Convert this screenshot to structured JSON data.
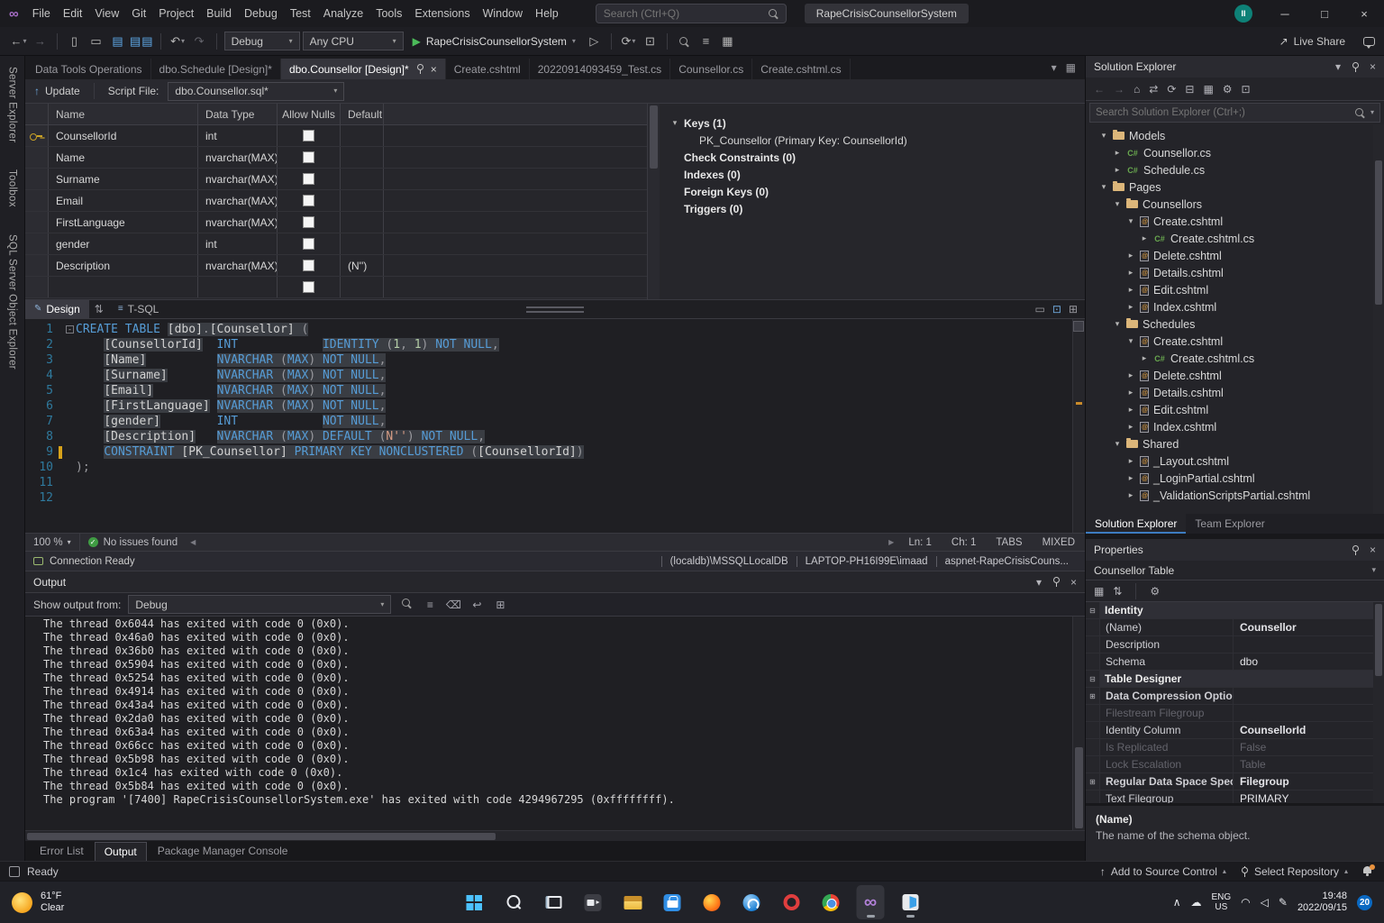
{
  "titlebar": {
    "menus": [
      "File",
      "Edit",
      "View",
      "Git",
      "Project",
      "Build",
      "Debug",
      "Test",
      "Analyze",
      "Tools",
      "Extensions",
      "Window",
      "Help"
    ],
    "search_placeholder": "Search (Ctrl+Q)",
    "project_pill": "RapeCrisisCounsellorSystem",
    "avatar_initials": "II"
  },
  "toolbar": {
    "config": "Debug",
    "platform": "Any CPU",
    "run": "RapeCrisisCounsellorSystem",
    "live_share": "Live Share"
  },
  "tabs": [
    {
      "label": "Data Tools Operations",
      "active": false
    },
    {
      "label": "dbo.Schedule [Design]*",
      "active": false
    },
    {
      "label": "dbo.Counsellor [Design]*",
      "active": true
    },
    {
      "label": "Create.cshtml",
      "active": false
    },
    {
      "label": "20220914093459_Test.cs",
      "active": false
    },
    {
      "label": "Counsellor.cs",
      "active": false
    },
    {
      "label": "Create.cshtml.cs",
      "active": false
    }
  ],
  "designer": {
    "update_button": "Update",
    "script_file_label": "Script File:",
    "script_file_value": "dbo.Counsellor.sql*",
    "view_tabs": [
      "Design",
      "T-SQL"
    ],
    "grid": {
      "columns": [
        "Name",
        "Data Type",
        "Allow Nulls",
        "Default"
      ],
      "rows": [
        {
          "key": true,
          "name": "CounsellorId",
          "type": "int",
          "default": ""
        },
        {
          "key": false,
          "name": "Name",
          "type": "nvarchar(MAX)",
          "default": ""
        },
        {
          "key": false,
          "name": "Surname",
          "type": "nvarchar(MAX)",
          "default": ""
        },
        {
          "key": false,
          "name": "Email",
          "type": "nvarchar(MAX)",
          "default": ""
        },
        {
          "key": false,
          "name": "FirstLanguage",
          "type": "nvarchar(MAX)",
          "default": ""
        },
        {
          "key": false,
          "name": "gender",
          "type": "int",
          "default": ""
        },
        {
          "key": false,
          "name": "Description",
          "type": "nvarchar(MAX)",
          "default": "(N'')"
        }
      ]
    },
    "context_panel": [
      {
        "label": "Keys (1)",
        "expander": "open",
        "child": "PK_Counsellor   (Primary Key: CounsellorId)"
      },
      {
        "label": "Check Constraints (0)"
      },
      {
        "label": "Indexes (0)"
      },
      {
        "label": "Foreign Keys (0)"
      },
      {
        "label": "Triggers (0)"
      }
    ]
  },
  "code": {
    "caret_line": 9,
    "lines": [
      [
        [
          "kw",
          "CREATE"
        ],
        [
          "pun",
          " "
        ],
        [
          "kw",
          "TABLE"
        ],
        [
          "pun",
          " "
        ],
        [
          "id hl",
          "[dbo]"
        ],
        [
          "pun hl",
          "."
        ],
        [
          "id hl",
          "[Counsellor]"
        ],
        [
          "pun hl",
          " ("
        ]
      ],
      [
        [
          "pun",
          "    "
        ],
        [
          "id hl",
          "[CounsellorId]"
        ],
        [
          "pun",
          "  "
        ],
        [
          "kw",
          "INT"
        ],
        [
          "pun",
          "            "
        ],
        [
          "kw hl",
          "IDENTITY"
        ],
        [
          "pun hl",
          " ("
        ],
        [
          "num hl",
          "1"
        ],
        [
          "pun hl",
          ", "
        ],
        [
          "num hl",
          "1"
        ],
        [
          "pun hl",
          ") "
        ],
        [
          "kw hl",
          "NOT NULL"
        ],
        [
          "pun hl",
          ","
        ]
      ],
      [
        [
          "pun",
          "    "
        ],
        [
          "id hl",
          "[Name]"
        ],
        [
          "pun",
          "          "
        ],
        [
          "kw hl",
          "NVARCHAR"
        ],
        [
          "pun hl",
          " ("
        ],
        [
          "kw hl",
          "MAX"
        ],
        [
          "pun hl",
          ") "
        ],
        [
          "kw hl",
          "NOT NULL"
        ],
        [
          "pun hl",
          ","
        ]
      ],
      [
        [
          "pun",
          "    "
        ],
        [
          "id hl",
          "[Surname]"
        ],
        [
          "pun",
          "       "
        ],
        [
          "kw hl",
          "NVARCHAR"
        ],
        [
          "pun hl",
          " ("
        ],
        [
          "kw hl",
          "MAX"
        ],
        [
          "pun hl",
          ") "
        ],
        [
          "kw hl",
          "NOT NULL"
        ],
        [
          "pun hl",
          ","
        ]
      ],
      [
        [
          "pun",
          "    "
        ],
        [
          "id hl",
          "[Email]"
        ],
        [
          "pun",
          "         "
        ],
        [
          "kw hl",
          "NVARCHAR"
        ],
        [
          "pun hl",
          " ("
        ],
        [
          "kw hl",
          "MAX"
        ],
        [
          "pun hl",
          ") "
        ],
        [
          "kw hl",
          "NOT NULL"
        ],
        [
          "pun hl",
          ","
        ]
      ],
      [
        [
          "pun",
          "    "
        ],
        [
          "id hl",
          "[FirstLanguage]"
        ],
        [
          "pun",
          " "
        ],
        [
          "kw hl",
          "NVARCHAR"
        ],
        [
          "pun hl",
          " ("
        ],
        [
          "kw hl",
          "MAX"
        ],
        [
          "pun hl",
          ") "
        ],
        [
          "kw hl",
          "NOT NULL"
        ],
        [
          "pun hl",
          ","
        ]
      ],
      [
        [
          "pun",
          "    "
        ],
        [
          "id hl",
          "[gender]"
        ],
        [
          "pun",
          "        "
        ],
        [
          "kw",
          "INT"
        ],
        [
          "pun",
          "            "
        ],
        [
          "kw hl",
          "NOT NULL"
        ],
        [
          "pun hl",
          ","
        ]
      ],
      [
        [
          "pun",
          "    "
        ],
        [
          "id hl",
          "[Description]"
        ],
        [
          "pun",
          "   "
        ],
        [
          "kw hl",
          "NVARCHAR"
        ],
        [
          "pun hl",
          " ("
        ],
        [
          "kw hl",
          "MAX"
        ],
        [
          "pun hl",
          ") "
        ],
        [
          "kw hl",
          "DEFAULT"
        ],
        [
          "pun hl",
          " ("
        ],
        [
          "str hl",
          "N''"
        ],
        [
          "pun hl",
          ") "
        ],
        [
          "kw hl",
          "NOT NULL"
        ],
        [
          "pun hl",
          ","
        ]
      ],
      [
        [
          "pun",
          "    "
        ],
        [
          "kw hl",
          "CONSTRAINT"
        ],
        [
          "pun hl",
          " "
        ],
        [
          "id hl",
          "[PK_Counsellor]"
        ],
        [
          "pun hl",
          " "
        ],
        [
          "kw hl",
          "PRIMARY KEY NONCLUSTERED"
        ],
        [
          "pun hl",
          " ("
        ],
        [
          "id hl",
          "[CounsellorId]"
        ],
        [
          "pun hl",
          ")"
        ]
      ],
      [
        [
          "pun",
          ");"
        ]
      ],
      [],
      []
    ]
  },
  "editor_status": {
    "zoom": "100 %",
    "issues": "No issues found",
    "ln": "Ln: 1",
    "ch": "Ch: 1",
    "tabs": "TABS",
    "mode": "MIXED"
  },
  "connection": {
    "status": "Connection Ready",
    "items": [
      "(localdb)\\MSSQLLocalDB",
      "LAPTOP-PH16I99E\\imaad",
      "aspnet-RapeCrisisCouns..."
    ]
  },
  "output": {
    "title": "Output",
    "show_from_label": "Show output from:",
    "source": "Debug",
    "lines": [
      "The thread 0x6044 has exited with code 0 (0x0).",
      "The thread 0x46a0 has exited with code 0 (0x0).",
      "The thread 0x36b0 has exited with code 0 (0x0).",
      "The thread 0x5904 has exited with code 0 (0x0).",
      "The thread 0x5254 has exited with code 0 (0x0).",
      "The thread 0x4914 has exited with code 0 (0x0).",
      "The thread 0x43a4 has exited with code 0 (0x0).",
      "The thread 0x2da0 has exited with code 0 (0x0).",
      "The thread 0x63a4 has exited with code 0 (0x0).",
      "The thread 0x66cc has exited with code 0 (0x0).",
      "The thread 0x5b98 has exited with code 0 (0x0).",
      "The thread 0x1c4 has exited with code 0 (0x0).",
      "The thread 0x5b84 has exited with code 0 (0x0).",
      "The program '[7400] RapeCrisisCounsellorSystem.exe' has exited with code 4294967295 (0xffffffff)."
    ]
  },
  "panel_tabs": [
    {
      "label": "Error List",
      "active": false
    },
    {
      "label": "Output",
      "active": true
    },
    {
      "label": "Package Manager Console",
      "active": false
    }
  ],
  "solution_explorer": {
    "title": "Solution Explorer",
    "search_placeholder": "Search Solution Explorer (Ctrl+;)",
    "tree": [
      {
        "d": 1,
        "exp": "open",
        "icon": "folder",
        "label": "Models"
      },
      {
        "d": 2,
        "exp": "closed",
        "icon": "cs",
        "label": "Counsellor.cs"
      },
      {
        "d": 2,
        "exp": "closed",
        "icon": "cs",
        "label": "Schedule.cs"
      },
      {
        "d": 1,
        "exp": "open",
        "icon": "folder",
        "label": "Pages"
      },
      {
        "d": 2,
        "exp": "open",
        "icon": "folder",
        "label": "Counsellors"
      },
      {
        "d": 3,
        "exp": "open",
        "icon": "cshtml",
        "label": "Create.cshtml"
      },
      {
        "d": 4,
        "exp": "closed",
        "icon": "cs",
        "label": "Create.cshtml.cs"
      },
      {
        "d": 3,
        "exp": "closed",
        "icon": "cshtml",
        "label": "Delete.cshtml"
      },
      {
        "d": 3,
        "exp": "closed",
        "icon": "cshtml",
        "label": "Details.cshtml"
      },
      {
        "d": 3,
        "exp": "closed",
        "icon": "cshtml",
        "label": "Edit.cshtml"
      },
      {
        "d": 3,
        "exp": "closed",
        "icon": "cshtml",
        "label": "Index.cshtml"
      },
      {
        "d": 2,
        "exp": "open",
        "icon": "folder",
        "label": "Schedules"
      },
      {
        "d": 3,
        "exp": "open",
        "icon": "cshtml",
        "label": "Create.cshtml"
      },
      {
        "d": 4,
        "exp": "closed",
        "icon": "cs",
        "label": "Create.cshtml.cs"
      },
      {
        "d": 3,
        "exp": "closed",
        "icon": "cshtml",
        "label": "Delete.cshtml"
      },
      {
        "d": 3,
        "exp": "closed",
        "icon": "cshtml",
        "label": "Details.cshtml"
      },
      {
        "d": 3,
        "exp": "closed",
        "icon": "cshtml",
        "label": "Edit.cshtml"
      },
      {
        "d": 3,
        "exp": "closed",
        "icon": "cshtml",
        "label": "Index.cshtml"
      },
      {
        "d": 2,
        "exp": "open",
        "icon": "folder",
        "label": "Shared"
      },
      {
        "d": 3,
        "exp": "closed",
        "icon": "cshtml",
        "label": "_Layout.cshtml"
      },
      {
        "d": 3,
        "exp": "closed",
        "icon": "cshtml",
        "label": "_LoginPartial.cshtml"
      },
      {
        "d": 3,
        "exp": "closed",
        "icon": "cshtml",
        "label": "_ValidationScriptsPartial.cshtml"
      }
    ],
    "tabs": [
      {
        "label": "Solution Explorer",
        "active": true
      },
      {
        "label": "Team Explorer",
        "active": false
      }
    ]
  },
  "properties": {
    "title": "Properties",
    "object": "Counsellor Table",
    "groups": [
      {
        "label": "Identity",
        "rows": [
          {
            "name": "(Name)",
            "value": "Counsellor",
            "value_bold": true
          },
          {
            "name": "Description",
            "value": ""
          },
          {
            "name": "Schema",
            "value": "dbo"
          }
        ]
      },
      {
        "label": "Table Designer",
        "rows": [
          {
            "name": "Data Compression Option",
            "value": "",
            "expand": true,
            "name_bold": true
          },
          {
            "name": "Filestream Filegroup",
            "value": "",
            "dim": true
          },
          {
            "name": "Identity Column",
            "value": "CounsellorId",
            "value_bold": true
          },
          {
            "name": "Is Replicated",
            "value": "False",
            "dim": true
          },
          {
            "name": "Lock Escalation",
            "value": "Table",
            "dim": true
          },
          {
            "name": "Regular Data Space Specif",
            "value": "Filegroup",
            "expand": true,
            "name_bold": true,
            "value_bold": true
          },
          {
            "name": "Text Filegroup",
            "value": "PRIMARY"
          }
        ]
      }
    ],
    "help_title": "(Name)",
    "help_text": "The name of the schema object."
  },
  "status_bar": {
    "ready": "Ready",
    "add_source_control": "Add to Source Control",
    "select_repository": "Select Repository"
  },
  "left_strip": [
    "Server Explorer",
    "Toolbox",
    "SQL Server Object Explorer"
  ],
  "taskbar": {
    "weather_temp": "61°F",
    "weather_desc": "Clear",
    "apps": [
      {
        "name": "start"
      },
      {
        "name": "search"
      },
      {
        "name": "task-view"
      },
      {
        "name": "camera"
      },
      {
        "name": "file-explorer"
      },
      {
        "name": "store"
      },
      {
        "name": "firefox"
      },
      {
        "name": "edge"
      },
      {
        "name": "opera"
      },
      {
        "name": "chrome"
      },
      {
        "name": "visual-studio",
        "open": true,
        "active": true
      },
      {
        "name": "code-app",
        "open": true
      }
    ],
    "tray": {
      "lang_top": "ENG",
      "lang_bottom": "US",
      "time": "19:48",
      "date": "2022/09/15",
      "badge": "20"
    }
  }
}
